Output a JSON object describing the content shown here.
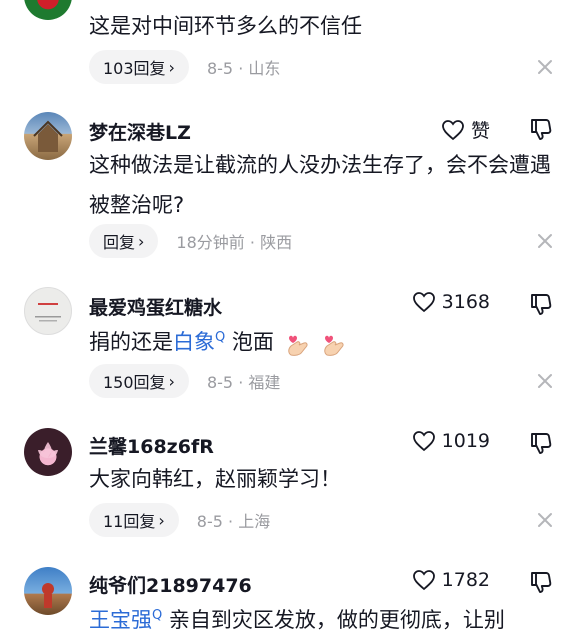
{
  "comments": [
    {
      "text": "这是对中间环节多么的不信任",
      "reply_label": "103回复",
      "date": "8-5",
      "location": "山东"
    },
    {
      "username": "梦在深巷LZ",
      "like_label": "赞",
      "text": "这种做法是让截流的人没办法生存了，会不会遭遇被整治呢?",
      "reply_label": "回复",
      "date": "18分钟前",
      "location": "陕西"
    },
    {
      "username": "最爱鸡蛋红糖水",
      "like_label": "3168",
      "text_before": "捐的还是",
      "text_link": "白象",
      "text_after": "泡面",
      "reply_label": "150回复",
      "date": "8-5",
      "location": "福建"
    },
    {
      "username": "兰馨168z6fR",
      "like_label": "1019",
      "text": "大家向韩红，赵丽颖学习！",
      "reply_label": "11回复",
      "date": "8-5",
      "location": "上海"
    },
    {
      "username": "纯爷们21897476",
      "like_label": "1782",
      "text_link": "王宝强",
      "text_after": "亲自到灾区发放，做的更彻底，让别"
    }
  ],
  "meta_separator": "·",
  "chevron_glyph": "›",
  "search_glyph": "Q",
  "icons": {
    "like": "heart-outline-icon",
    "dislike": "thumbs-down-icon",
    "close": "close-x-icon",
    "search": "search-q-icon",
    "emoji": "finger-heart-emoji-icon"
  },
  "colors": {
    "link": "#2b6bd6",
    "meta": "#9a9ba0",
    "reply_bg": "#f3f3f4",
    "text": "#161823"
  }
}
